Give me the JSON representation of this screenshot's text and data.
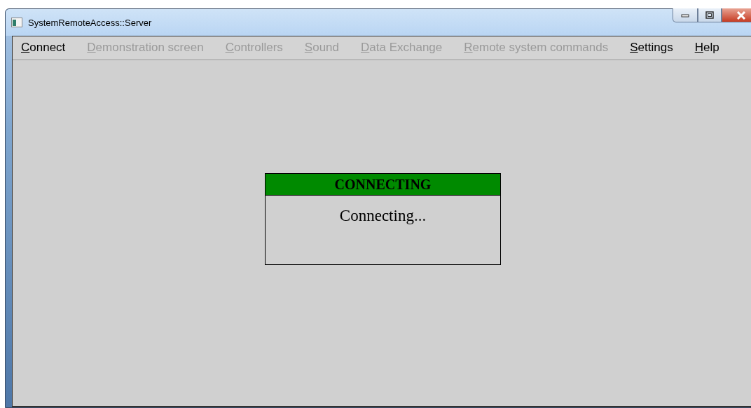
{
  "window": {
    "title": "SystemRemoteAccess::Server"
  },
  "menu": [
    {
      "label": "Connect",
      "disabled": false
    },
    {
      "label": "Demonstration screen",
      "disabled": true
    },
    {
      "label": "Controllers",
      "disabled": true
    },
    {
      "label": "Sound",
      "disabled": true
    },
    {
      "label": "Data Exchange",
      "disabled": true
    },
    {
      "label": "Remote system commands",
      "disabled": true
    },
    {
      "label": "Settings",
      "disabled": false
    },
    {
      "label": "Help",
      "disabled": false
    }
  ],
  "dialog": {
    "title": "CONNECTING",
    "message": "Connecting..."
  }
}
